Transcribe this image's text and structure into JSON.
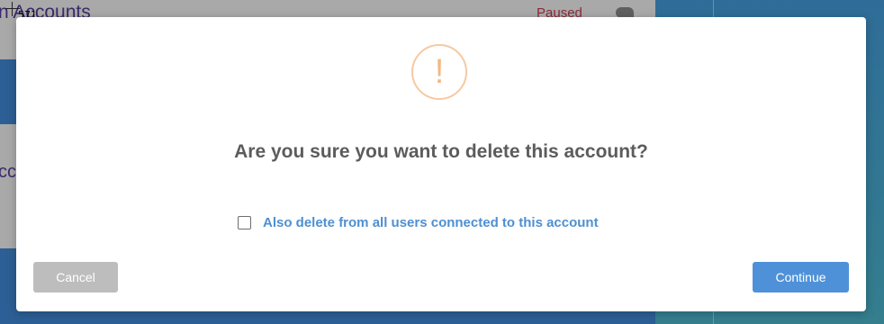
{
  "background": {
    "list_title": "n Accounts",
    "status": "Paused",
    "partial_text": "cc",
    "cursor_coords": [
      "571",
      "442"
    ]
  },
  "dialog": {
    "icon": "exclamation-warning-icon",
    "icon_glyph": "!",
    "question": "Are you sure you want to delete this account?",
    "checkbox": {
      "checked": false,
      "label": "Also delete from all users connected to this account"
    },
    "cancel_label": "Cancel",
    "continue_label": "Continue"
  },
  "colors": {
    "accent": "#4e91d8",
    "warning": "#f2b883",
    "cancel": "#bdbdbd"
  }
}
